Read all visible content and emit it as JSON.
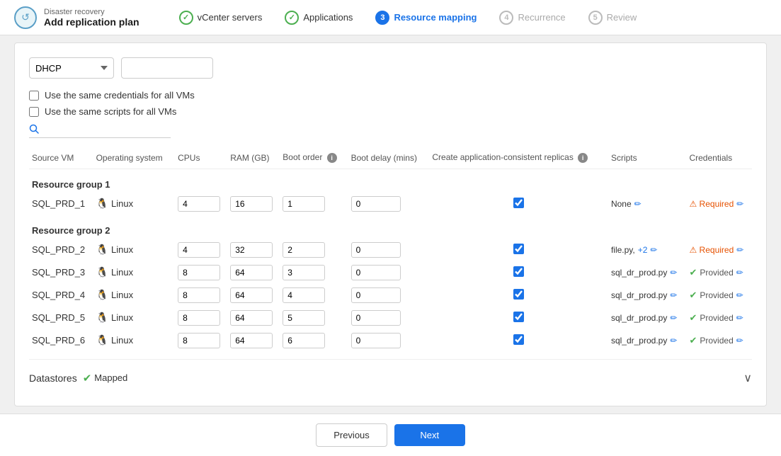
{
  "brand": {
    "subtitle": "Disaster recovery",
    "title": "Add replication plan",
    "icon": "↺"
  },
  "wizard": {
    "steps": [
      {
        "id": 1,
        "label": "vCenter servers",
        "state": "completed"
      },
      {
        "id": 2,
        "label": "Applications",
        "state": "completed"
      },
      {
        "id": 3,
        "label": "Resource mapping",
        "state": "active"
      },
      {
        "id": 4,
        "label": "Recurrence",
        "state": "inactive"
      },
      {
        "id": 5,
        "label": "Review",
        "state": "inactive"
      }
    ]
  },
  "controls": {
    "dhcp_value": "DHCP",
    "checkbox1": "Use the same credentials for all VMs",
    "checkbox2": "Use the same scripts for all VMs",
    "search_placeholder": ""
  },
  "table": {
    "columns": [
      "Source VM",
      "Operating system",
      "CPUs",
      "RAM (GB)",
      "Boot order",
      "Boot delay (mins)",
      "Create application-consistent replicas",
      "Scripts",
      "Credentials"
    ],
    "groups": [
      {
        "label": "Resource group 1",
        "rows": [
          {
            "vm": "SQL_PRD_1",
            "os": "Linux",
            "cpus": "4",
            "ram": "16",
            "boot_order": "1",
            "boot_delay": "0",
            "checked": true,
            "script": "None",
            "script_extra": "",
            "cred_state": "required",
            "cred_label": "Required"
          }
        ]
      },
      {
        "label": "Resource group 2",
        "rows": [
          {
            "vm": "SQL_PRD_2",
            "os": "Linux",
            "cpus": "4",
            "ram": "32",
            "boot_order": "2",
            "boot_delay": "0",
            "checked": true,
            "script": "file.py,",
            "script_extra": "+2",
            "cred_state": "required",
            "cred_label": "Required"
          },
          {
            "vm": "SQL_PRD_3",
            "os": "Linux",
            "cpus": "8",
            "ram": "64",
            "boot_order": "3",
            "boot_delay": "0",
            "checked": true,
            "script": "sql_dr_prod.py",
            "script_extra": "",
            "cred_state": "provided",
            "cred_label": "Provided"
          },
          {
            "vm": "SQL_PRD_4",
            "os": "Linux",
            "cpus": "8",
            "ram": "64",
            "boot_order": "4",
            "boot_delay": "0",
            "checked": true,
            "script": "sql_dr_prod.py",
            "script_extra": "",
            "cred_state": "provided",
            "cred_label": "Provided"
          },
          {
            "vm": "SQL_PRD_5",
            "os": "Linux",
            "cpus": "8",
            "ram": "64",
            "boot_order": "5",
            "boot_delay": "0",
            "checked": true,
            "script": "sql_dr_prod.py",
            "script_extra": "",
            "cred_state": "provided",
            "cred_label": "Provided"
          },
          {
            "vm": "SQL_PRD_6",
            "os": "Linux",
            "cpus": "8",
            "ram": "64",
            "boot_order": "6",
            "boot_delay": "0",
            "checked": true,
            "script": "sql_dr_prod.py",
            "script_extra": "",
            "cred_state": "provided",
            "cred_label": "Provided"
          }
        ]
      }
    ]
  },
  "datastores": {
    "label": "Datastores",
    "status": "Mapped"
  },
  "footer": {
    "prev_label": "Previous",
    "next_label": "Next"
  }
}
